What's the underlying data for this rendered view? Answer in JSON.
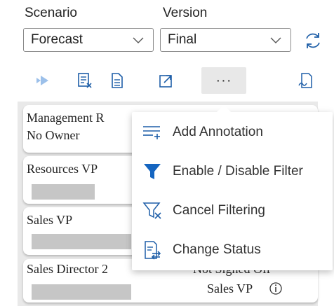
{
  "scenario": {
    "label": "Scenario",
    "value": "Forecast"
  },
  "version": {
    "label": "Version",
    "value": "Final"
  },
  "toolbar": {
    "more_label": "···"
  },
  "cards": [
    {
      "line1": "Management R",
      "line2": "No Owner"
    },
    {
      "line1": "Resources VP",
      "line2": ""
    },
    {
      "line1": "Sales VP",
      "line2": ""
    },
    {
      "line1": "Sales Director 2",
      "status": "Not Signed Off",
      "owner": "Sales VP"
    }
  ],
  "menu": {
    "items": [
      {
        "label": "Add Annotation",
        "icon": "add-annotation-icon"
      },
      {
        "label": "Enable / Disable Filter",
        "icon": "filter-icon"
      },
      {
        "label": "Cancel Filtering",
        "icon": "clear-filter-icon"
      },
      {
        "label": "Change Status",
        "icon": "change-status-icon"
      }
    ]
  },
  "colors": {
    "accent": "#1565c0",
    "toolbar_icon": "#1f5fa8",
    "placeholder_bar": "#c6c6c6"
  }
}
